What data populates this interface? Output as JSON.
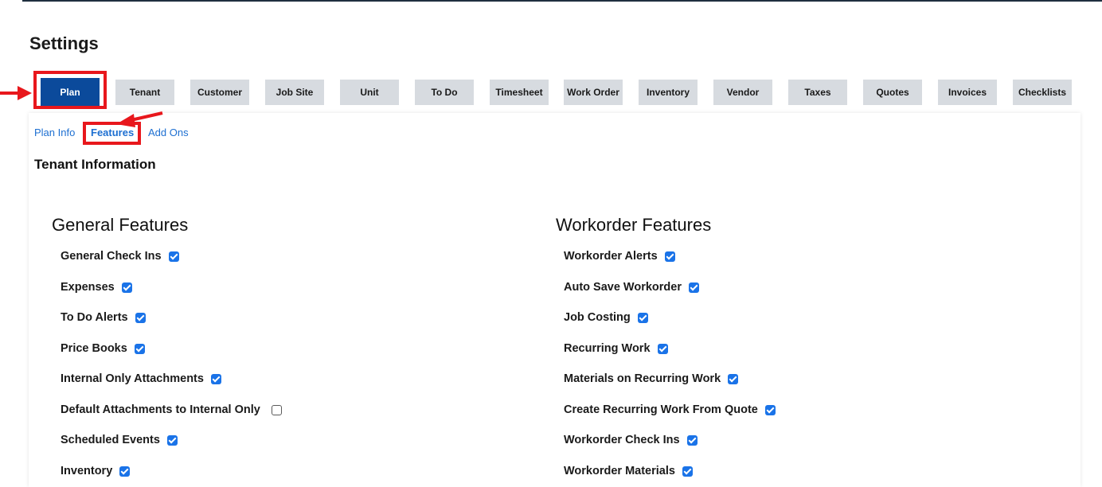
{
  "page": {
    "title": "Settings"
  },
  "tabs": [
    {
      "label": "Plan",
      "active": true
    },
    {
      "label": "Tenant"
    },
    {
      "label": "Customer"
    },
    {
      "label": "Job Site"
    },
    {
      "label": "Unit"
    },
    {
      "label": "To Do"
    },
    {
      "label": "Timesheet"
    },
    {
      "label": "Work Order"
    },
    {
      "label": "Inventory"
    },
    {
      "label": "Vendor"
    },
    {
      "label": "Taxes"
    },
    {
      "label": "Quotes"
    },
    {
      "label": "Invoices"
    },
    {
      "label": "Checklists"
    }
  ],
  "subtabs": [
    {
      "label": "Plan Info"
    },
    {
      "label": "Features",
      "active": true
    },
    {
      "label": "Add Ons"
    }
  ],
  "section": {
    "heading": "Tenant Information"
  },
  "general": {
    "heading": "General Features",
    "items": [
      {
        "label": "General Check Ins",
        "checked": true
      },
      {
        "label": "Expenses",
        "checked": true
      },
      {
        "label": "To Do Alerts",
        "checked": true
      },
      {
        "label": "Price Books",
        "checked": true
      },
      {
        "label": "Internal Only Attachments",
        "checked": true
      },
      {
        "label": "Default Attachments to Internal Only",
        "checked": false
      },
      {
        "label": "Scheduled Events",
        "checked": true
      },
      {
        "label": "Inventory",
        "checked": true
      }
    ]
  },
  "workorder": {
    "heading": "Workorder Features",
    "items": [
      {
        "label": "Workorder Alerts",
        "checked": true
      },
      {
        "label": "Auto Save Workorder",
        "checked": true
      },
      {
        "label": "Job Costing",
        "checked": true
      },
      {
        "label": "Recurring Work",
        "checked": true
      },
      {
        "label": "Materials on Recurring Work",
        "checked": true
      },
      {
        "label": "Create Recurring Work From Quote",
        "checked": true
      },
      {
        "label": "Workorder Check Ins",
        "checked": true
      },
      {
        "label": "Workorder Materials",
        "checked": true
      }
    ]
  },
  "colors": {
    "accent": "#0b4a9b",
    "link": "#1d6fd1",
    "checkbox": "#1a73e8",
    "annotation": "#e8171c",
    "tab_bg": "#d7dbe0"
  }
}
